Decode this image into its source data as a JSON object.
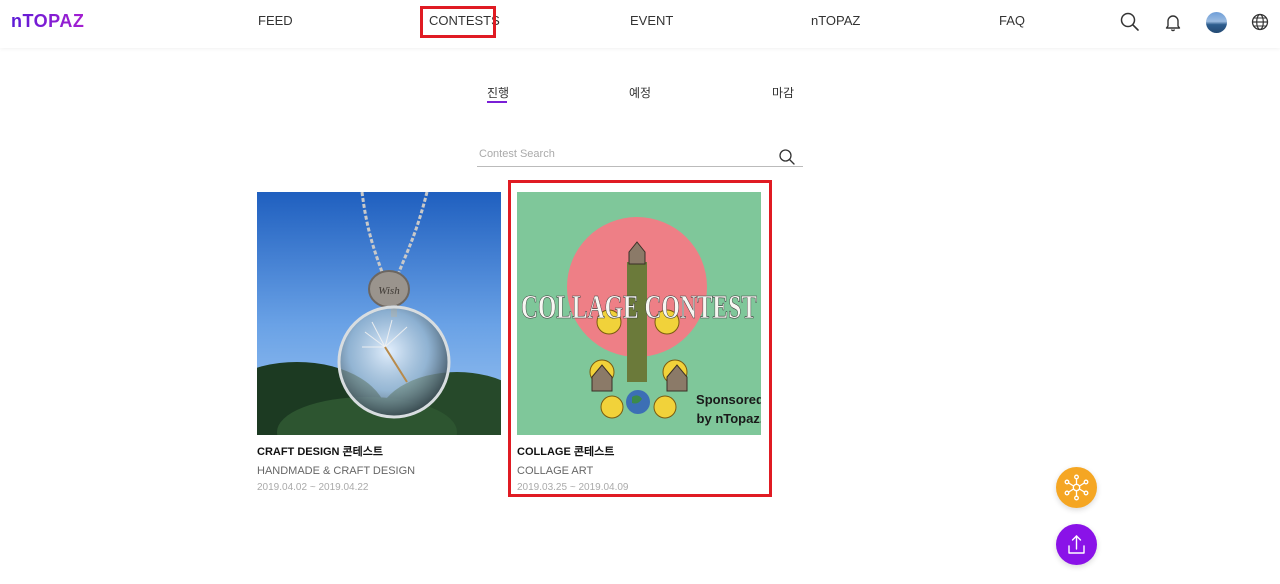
{
  "header": {
    "logo": "nTOPAZ",
    "nav": [
      {
        "label": "FEED"
      },
      {
        "label": "CONTESTS"
      },
      {
        "label": "EVENT"
      },
      {
        "label": "nTOPAZ"
      },
      {
        "label": "FAQ"
      }
    ],
    "icons": [
      "search-icon",
      "bell-icon",
      "avatar",
      "globe-icon"
    ]
  },
  "tabs": [
    {
      "label": "진행",
      "active": true
    },
    {
      "label": "예정",
      "active": false
    },
    {
      "label": "마감",
      "active": false
    }
  ],
  "search": {
    "placeholder": "Contest Search",
    "value": ""
  },
  "cards": [
    {
      "image": "pendant-necklace-photo",
      "pendant_text": "Wish",
      "title": "CRAFT DESIGN 콘테스트",
      "subtitle": "HANDMADE & CRAFT DESIGN",
      "date": "2019.04.02 ~ 2019.04.22"
    },
    {
      "image": "collage-contest-poster",
      "poster_title": "COLLAGE CONTEST",
      "poster_sponsor_line1": "Sponsored",
      "poster_sponsor_line2": "by nTopaz.",
      "title": "COLLAGE 콘테스트",
      "subtitle": "COLLAGE ART",
      "date": "2019.03.25 ~ 2019.04.09"
    }
  ],
  "fabs": [
    {
      "icon": "network-icon",
      "color": "#f5a623"
    },
    {
      "icon": "upload-icon",
      "color": "#8a12e8"
    }
  ],
  "colors": {
    "accent": "#7a1fd6",
    "highlight": "#e01b23"
  }
}
